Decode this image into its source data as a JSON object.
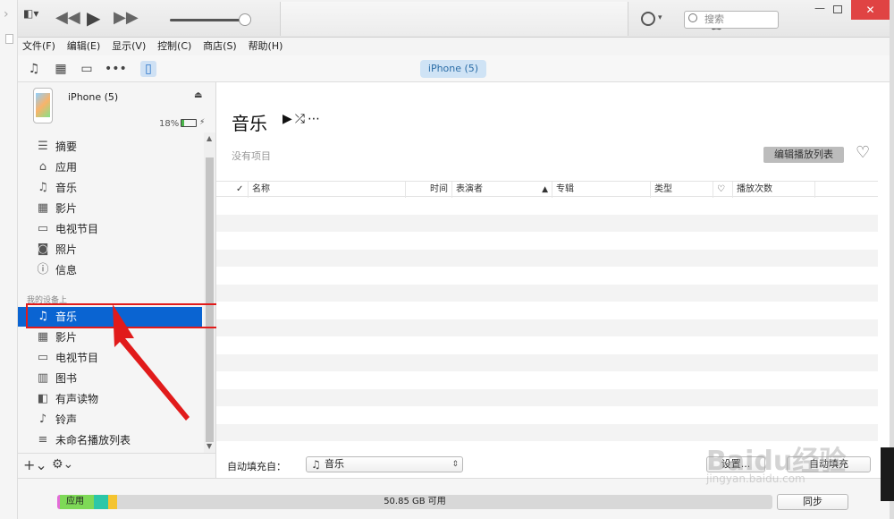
{
  "toolbar": {
    "search_placeholder": "搜索",
    "close": "✕",
    "minimize": "—"
  },
  "menu": [
    "文件(F)",
    "编辑(E)",
    "显示(V)",
    "控制(C)",
    "商店(S)",
    "帮助(H)"
  ],
  "media_icons": [
    "music-icon",
    "film-icon",
    "tv-icon",
    "more-icon",
    "phone-icon"
  ],
  "device": {
    "pill": "iPhone (5)",
    "name": "iPhone (5)",
    "battery_pct": "18%",
    "battery_level": 0.18
  },
  "sidebar": {
    "settings_items": [
      {
        "icon": "list-icon",
        "glyph": "☰",
        "label": "摘要"
      },
      {
        "icon": "apps-icon",
        "glyph": "⌂",
        "label": "应用"
      },
      {
        "icon": "music-icon",
        "glyph": "♫",
        "label": "音乐"
      },
      {
        "icon": "film-icon",
        "glyph": "▦",
        "label": "影片"
      },
      {
        "icon": "tv-icon",
        "glyph": "▭",
        "label": "电视节目"
      },
      {
        "icon": "camera-icon",
        "glyph": "◙",
        "label": "照片"
      },
      {
        "icon": "info-icon",
        "glyph": "ⓘ",
        "label": "信息"
      }
    ],
    "group_label": "我的设备上",
    "device_items": [
      {
        "icon": "music-icon",
        "glyph": "♫",
        "label": "音乐",
        "selected": true
      },
      {
        "icon": "film-icon",
        "glyph": "▦",
        "label": "影片"
      },
      {
        "icon": "tv-icon",
        "glyph": "▭",
        "label": "电视节目"
      },
      {
        "icon": "book-icon",
        "glyph": "▥",
        "label": "图书"
      },
      {
        "icon": "audiobook-icon",
        "glyph": "◧",
        "label": "有声读物"
      },
      {
        "icon": "bell-icon",
        "glyph": "♪",
        "label": "铃声"
      },
      {
        "icon": "playlist-icon",
        "glyph": "≡",
        "label": "未命名播放列表"
      }
    ]
  },
  "main": {
    "title": "音乐",
    "empty_note": "没有项目",
    "edit_playlist": "编辑播放列表",
    "columns": {
      "check": "✓",
      "name": "名称",
      "time": "时间",
      "artist": "表演者",
      "album": "专辑",
      "genre": "类型",
      "plays": "播放次数"
    },
    "autofill_label": "自动填充自：",
    "autofill_value": "音乐",
    "settings_btn": "设置...",
    "autofill_btn": "自动填充"
  },
  "status": {
    "apps_label": "应用",
    "available": "50.85 GB 可用",
    "sync": "同步",
    "colors": {
      "apps": "#7ed957",
      "pink": "#e46bd9",
      "teal": "#2cc7a8",
      "yellow": "#f4c430"
    }
  },
  "watermark": {
    "text": "Baidu经验",
    "sub": "jingyan.baidu.com"
  }
}
